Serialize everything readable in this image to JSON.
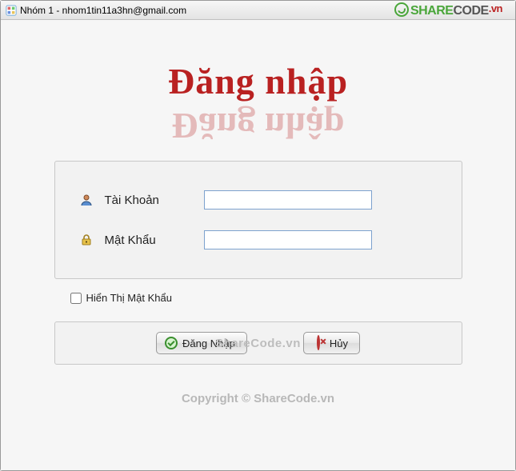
{
  "window": {
    "title": "Nhóm 1 - nhom1tin11a3hn@gmail.com"
  },
  "watermark": {
    "top_share": "SHARE",
    "top_code": "CODE",
    "top_tld": ".vn",
    "mid": "ShareCode.vn",
    "footer": "Copyright © ShareCode.vn"
  },
  "heading": "Đăng  nhập",
  "form": {
    "username_label": "Tài Khoản",
    "password_label": "Mật Khẩu",
    "username_value": "",
    "password_value": "",
    "show_password_label": "Hiển Thị Mật Khẩu"
  },
  "buttons": {
    "login_label": "Đăng Nhập",
    "cancel_label": "Hủy"
  },
  "icons": {
    "app": "app-icon",
    "user": "user-icon",
    "lock": "lock-icon",
    "ok": "ok-icon",
    "cancel": "cancel-icon"
  }
}
